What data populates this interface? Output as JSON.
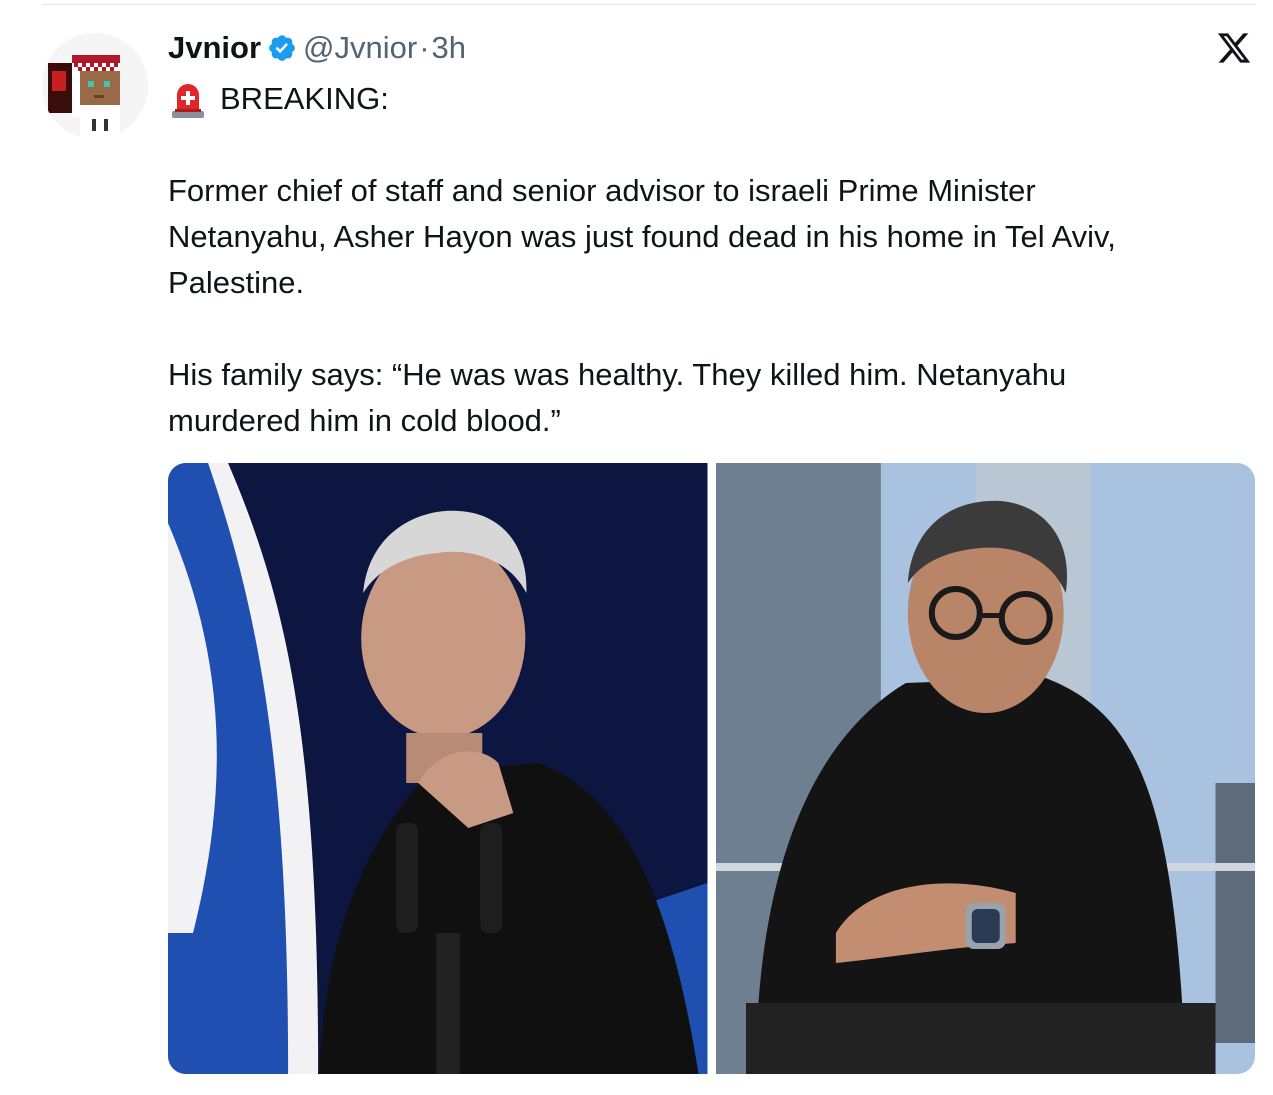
{
  "tweet": {
    "display_name": "Jvnior",
    "handle": "@Jvnior",
    "separator": "·",
    "time": "3h",
    "breaking": "BREAKING:",
    "paragraph1_lines": [
      "Former chief of staff and senior advisor to israeli Prime Minister",
      "Netanyahu, Asher Hayon was just found dead in his home in Tel Aviv,",
      "Palestine."
    ],
    "paragraph2_lines": [
      "His family says: “He was was healthy. They killed him. Netanyahu",
      "murdered him in cold blood.”"
    ]
  },
  "icons": {
    "verified": "verified-badge-icon",
    "platform": "x-logo-icon",
    "alert": "police-siren-icon"
  },
  "colors": {
    "text": "#0f1419",
    "secondary_text": "#536471",
    "verified_blue": "#1d9bf0"
  }
}
